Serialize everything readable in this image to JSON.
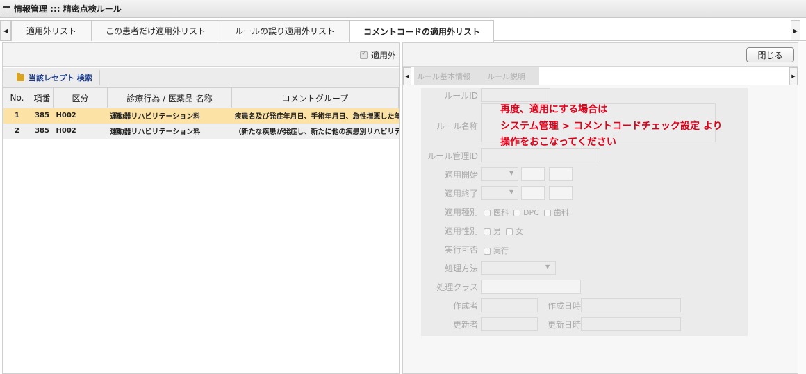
{
  "window": {
    "title": "情報管理 ::: 精密点検ルール"
  },
  "tabs": {
    "items": [
      {
        "label": "適用外リスト"
      },
      {
        "label": "この患者だけ適用外リスト"
      },
      {
        "label": "ルールの誤り適用外リスト"
      },
      {
        "label": "コメントコードの適用外リスト",
        "active": true
      }
    ],
    "left_arrow": "◀",
    "right_arrow": "▶"
  },
  "left_panel": {
    "applied_checkbox_label": "適用外",
    "applied_checked": true,
    "search_button": "当該レセプト 検索",
    "columns": [
      "No.",
      "項番",
      "区分",
      "診療行為 / 医薬品 名称",
      "コメントグループ"
    ],
    "rows": [
      {
        "no": "1",
        "item": "385",
        "category": "H002",
        "name": "運動器リハビリテーション料",
        "comment": "疾患名及び発症年月日、手術年月日、急性増悪した年月日",
        "selected": true
      },
      {
        "no": "2",
        "item": "385",
        "category": "H002",
        "name": "運動器リハビリテーション料",
        "comment": "（新たな疾患が発症し、新たに他の疾患別リハビリテーション",
        "selected": false
      }
    ]
  },
  "right_panel": {
    "close_button": "閉じる",
    "subtabs": [
      "ルール基本情報",
      "ルール説明"
    ],
    "form": {
      "rule_id_label": "ルールID",
      "rule_name_label": "ルール名称",
      "rule_mgmt_id_label": "ルール管理ID",
      "start_label": "適用開始",
      "end_label": "適用終了",
      "type_label": "適用種別",
      "type_options": [
        "医科",
        "DPC",
        "歯科"
      ],
      "gender_label": "適用性別",
      "gender_options": [
        "男",
        "女"
      ],
      "exec_label": "実行可否",
      "exec_option": "実行",
      "method_label": "処理方法",
      "class_label": "処理クラス",
      "creator_label": "作成者",
      "created_date_label": "作成日時",
      "updater_label": "更新者",
      "updated_date_label": "更新日時"
    },
    "notice": {
      "line1": "再度、適用にする場合は",
      "line2": "システム管理 > コメントコードチェック設定 より",
      "line3": "操作をおこなってください"
    }
  }
}
